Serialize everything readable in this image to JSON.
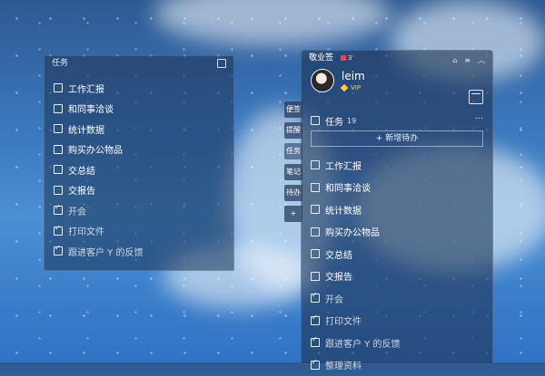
{
  "mini_widget": {
    "title": "任务",
    "items": [
      {
        "label": "工作汇报",
        "done": false
      },
      {
        "label": "和同事洽谈",
        "done": false
      },
      {
        "label": "统计数据",
        "done": false
      },
      {
        "label": "购买办公物品",
        "done": false
      },
      {
        "label": "交总结",
        "done": false
      },
      {
        "label": "交报告",
        "done": false
      },
      {
        "label": "开会",
        "done": true
      },
      {
        "label": "打印文件",
        "done": true
      },
      {
        "label": "跟进客户 Y 的反馈",
        "done": true
      }
    ]
  },
  "side_tabs": [
    {
      "label": "便签"
    },
    {
      "label": "提醒"
    },
    {
      "label": "任务"
    },
    {
      "label": "笔记"
    },
    {
      "label": "待办"
    },
    {
      "label": "+"
    }
  ],
  "main_panel": {
    "app_name": "敬业签",
    "badge_count": "3",
    "user": {
      "name": "leim",
      "vip_label": "VIP"
    },
    "task_section": {
      "title": "任务",
      "count": "19",
      "more": "···",
      "add_label": "+ 新增待办"
    },
    "items": [
      {
        "label": "工作汇报",
        "done": false
      },
      {
        "label": "和同事洽谈",
        "done": false
      },
      {
        "label": "统计数据",
        "done": false
      },
      {
        "label": "购买办公物品",
        "done": false
      },
      {
        "label": "交总结",
        "done": false
      },
      {
        "label": "交报告",
        "done": false
      },
      {
        "label": "开会",
        "done": true
      },
      {
        "label": "打印文件",
        "done": true
      },
      {
        "label": "跟进客户 Y 的反馈",
        "done": true
      },
      {
        "label": "整理资料",
        "done": true
      }
    ]
  }
}
